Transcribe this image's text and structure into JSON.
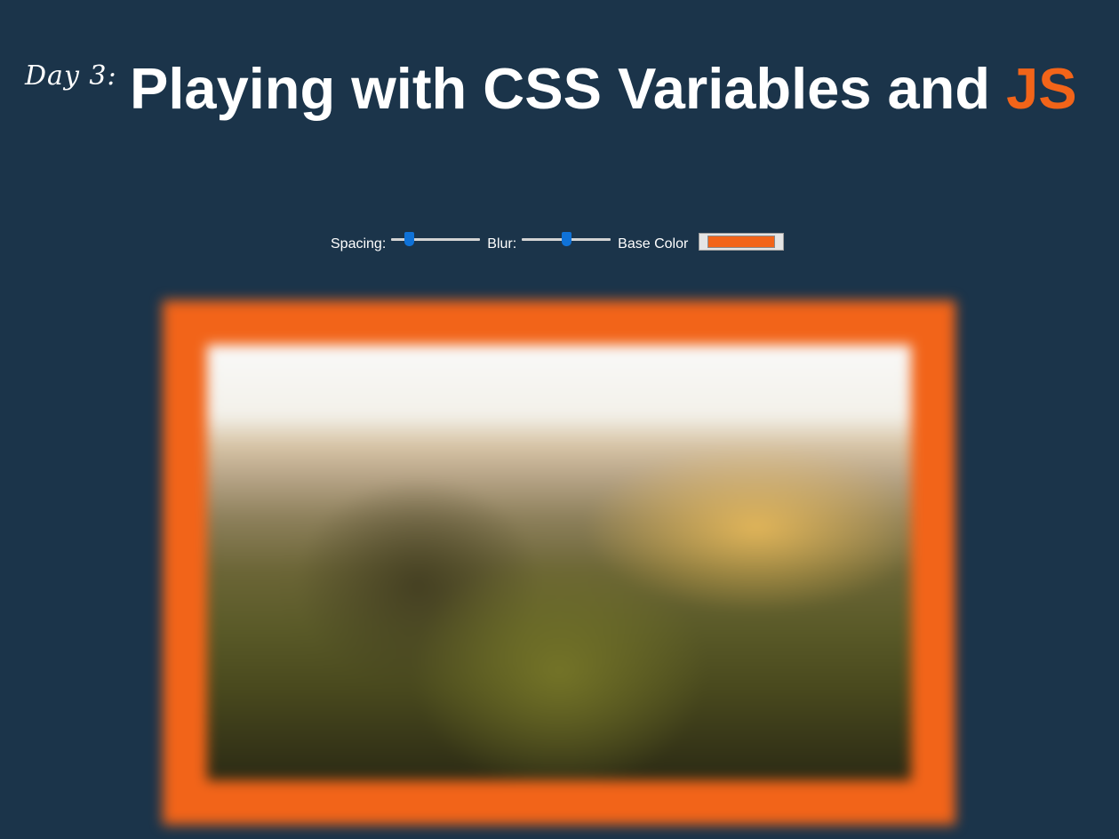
{
  "header": {
    "day_label": "Day 3:",
    "title_prefix": "Playing with CSS Variables and ",
    "title_highlight": "JS"
  },
  "controls": {
    "spacing": {
      "label": "Spacing:",
      "value": 10,
      "min": 0,
      "max": 50
    },
    "blur": {
      "label": "Blur:",
      "value": 10,
      "min": 0,
      "max": 20
    },
    "base_color": {
      "label": "Base Color",
      "value": "#f26419"
    }
  },
  "colors": {
    "background": "#1b344a",
    "accent": "#f26419",
    "text": "#ffffff",
    "slider_thumb": "#0f72d8"
  }
}
